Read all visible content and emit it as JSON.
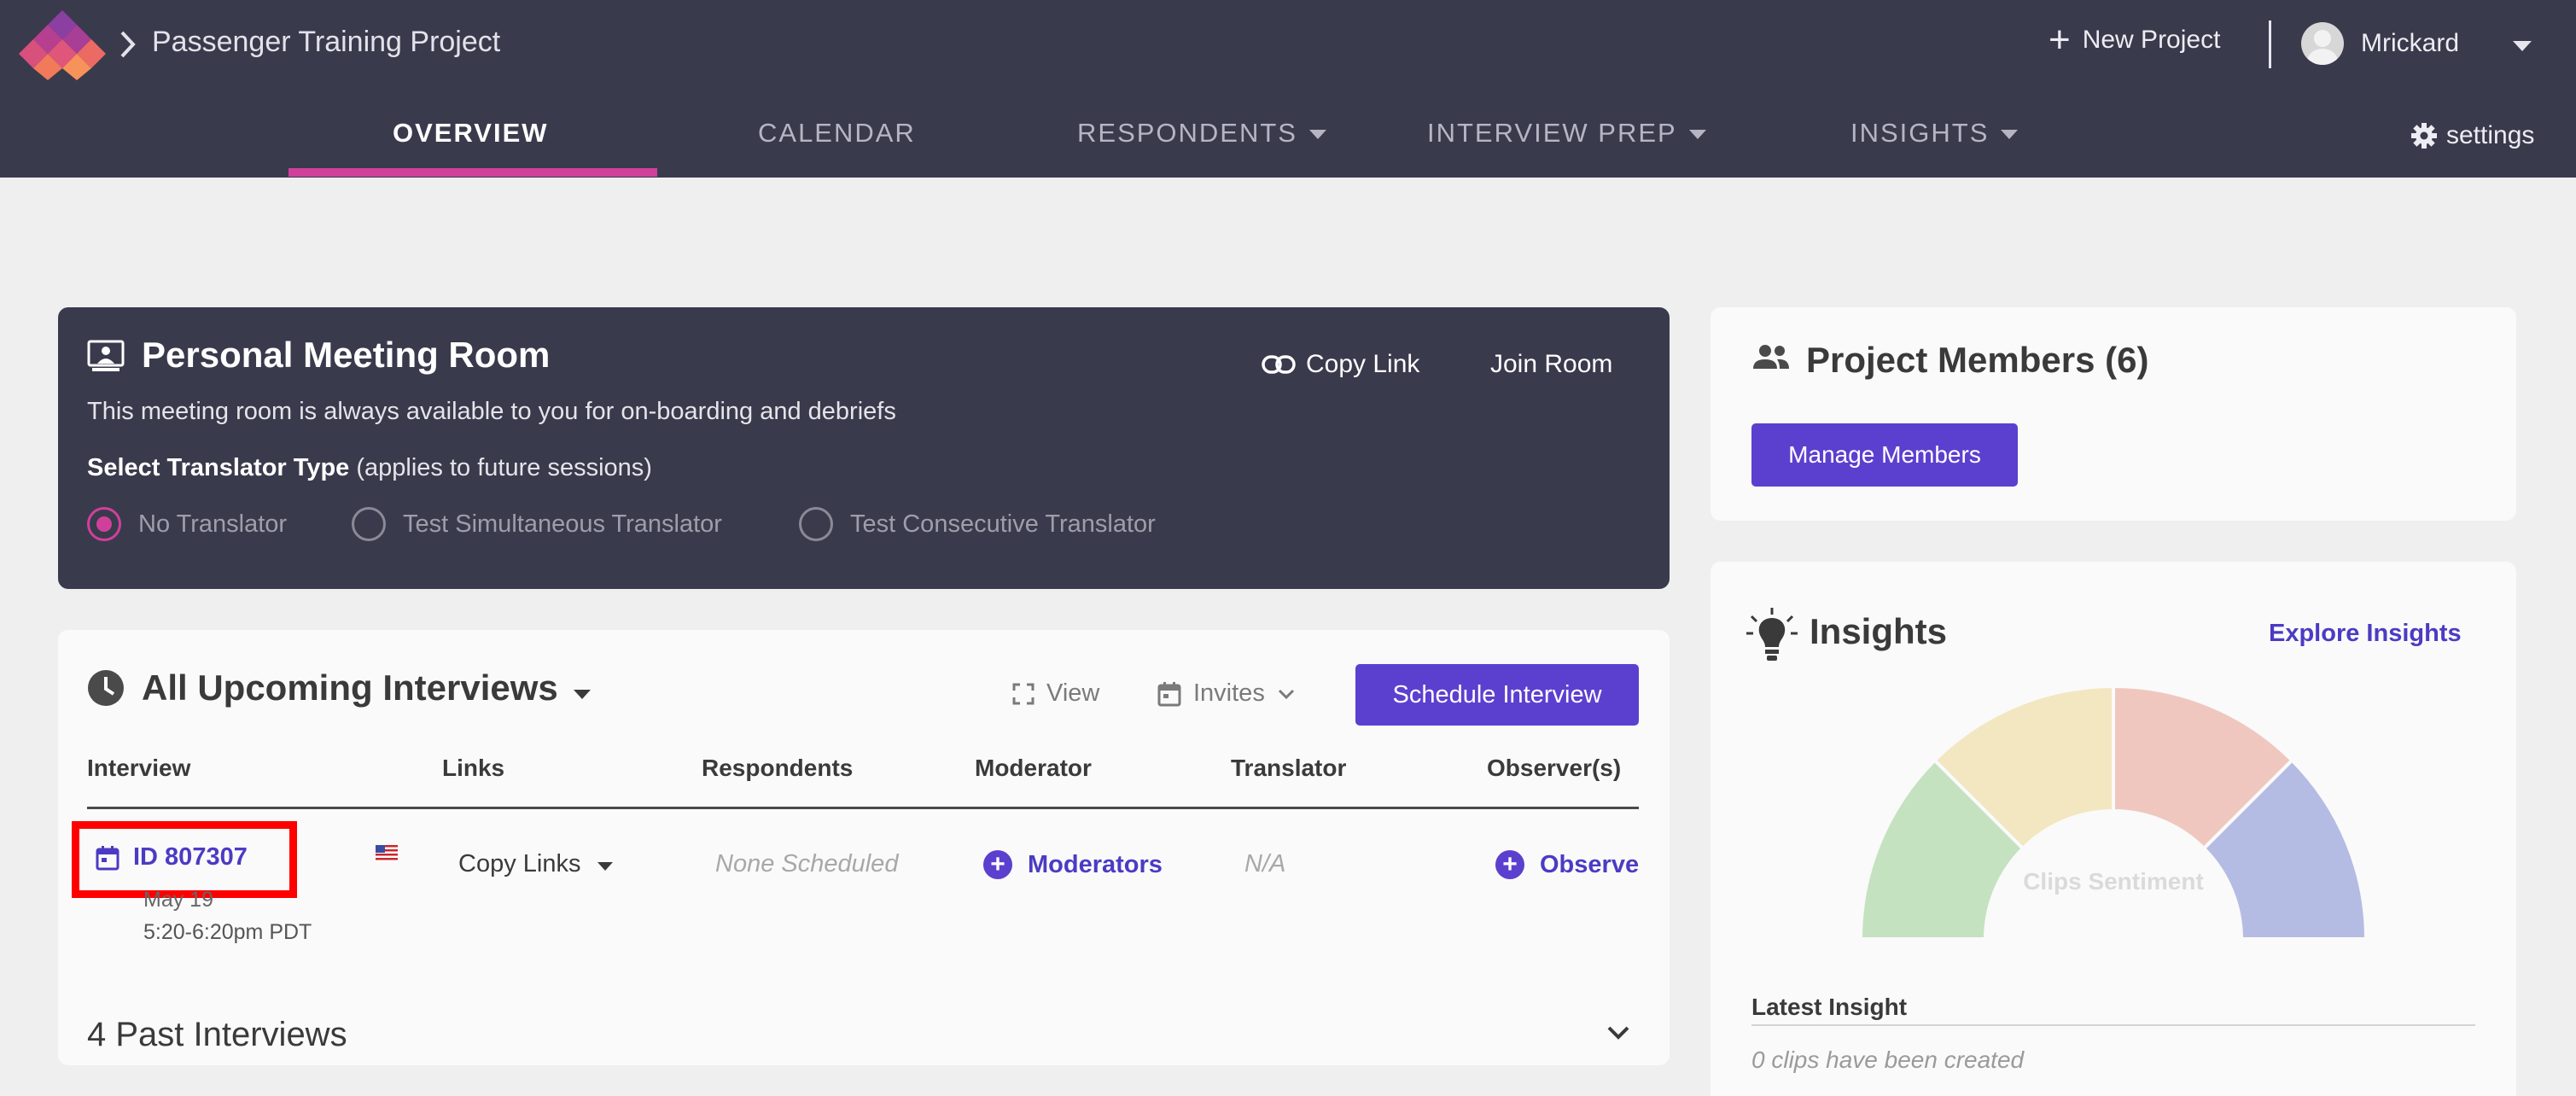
{
  "header": {
    "project_title": "Passenger Training Project",
    "new_project_label": "New Project",
    "user_name": "Mrickard",
    "settings_label": "settings",
    "tabs": [
      {
        "label": "OVERVIEW",
        "active": true
      },
      {
        "label": "CALENDAR"
      },
      {
        "label": "RESPONDENTS"
      },
      {
        "label": "INTERVIEW PREP"
      },
      {
        "label": "INSIGHTS"
      }
    ]
  },
  "meeting_room": {
    "title": "Personal Meeting Room",
    "copy_link_label": "Copy Link",
    "join_room_label": "Join Room",
    "description": "This meeting room is always available to you for on-boarding and debriefs",
    "translator_label": "Select Translator Type",
    "translator_note": "(applies to future sessions)",
    "translator_options": [
      "No Translator",
      "Test Simultaneous Translator",
      "Test Consecutive Translator"
    ],
    "selected_translator": "No Translator"
  },
  "interviews": {
    "title": "All Upcoming Interviews",
    "view_label": "View",
    "invites_label": "Invites",
    "schedule_label": "Schedule Interview",
    "columns": [
      "Interview",
      "Links",
      "Respondents",
      "Moderator",
      "Translator",
      "Observer(s)"
    ],
    "row": {
      "id": "ID 807307",
      "date": "May 19",
      "time": "5:20-6:20pm PDT",
      "links_label": "Copy Links",
      "respondents": "None Scheduled",
      "moderators_label": "Moderators",
      "translator": "N/A",
      "observers_label": "Observers"
    },
    "past_label": "4 Past Interviews"
  },
  "members": {
    "title": "Project Members (6)",
    "manage_label": "Manage Members"
  },
  "insights": {
    "title": "Insights",
    "explore_label": "Explore Insights",
    "gauge_label": "Clips Sentiment",
    "gauge_colors": [
      "#c4e2bf",
      "#f3e7c1",
      "#f0c7bf",
      "#b4bce3"
    ],
    "latest_label": "Latest Insight",
    "latest_text": "0 clips have been created"
  },
  "colors": {
    "header_bg": "#3a3a4d",
    "accent_pink": "#d0409b",
    "primary_purple": "#5b40cf",
    "highlight_red": "#ff0000"
  }
}
